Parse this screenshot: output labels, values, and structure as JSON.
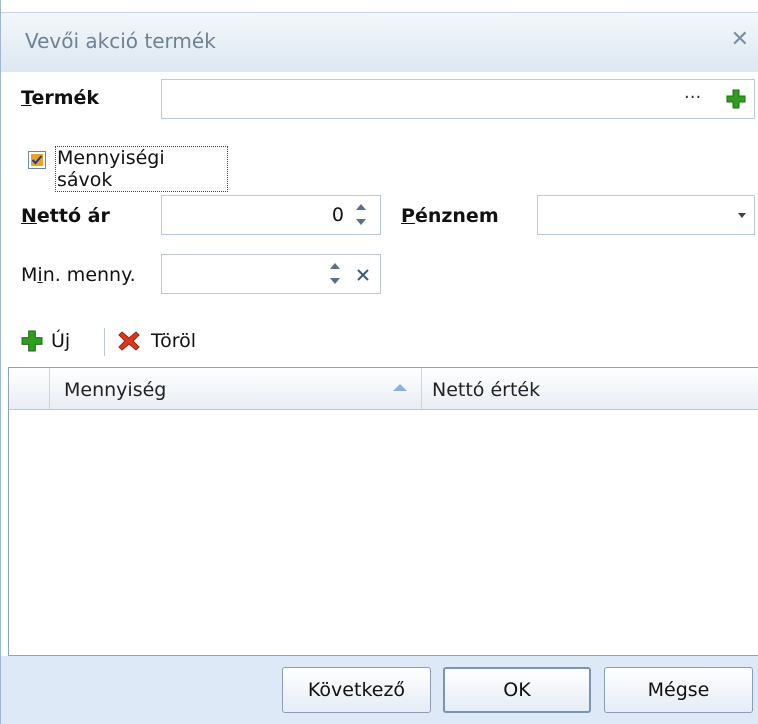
{
  "window": {
    "title": "Vevői akció termék",
    "close_glyph": "✕"
  },
  "form": {
    "product_label": "Termék",
    "product_value": "",
    "product_dots": "···",
    "checkbox_label": "Mennyiségi sávok",
    "checkbox_checked": true,
    "net_price_label": "Nettó ár",
    "net_price_value": "0",
    "currency_label": "Pénznem",
    "currency_value": "",
    "min_qty_label": "Min. menny.",
    "min_qty_value": ""
  },
  "toolbar": {
    "new_label": "Új",
    "delete_label": "Töröl"
  },
  "grid": {
    "columns": [
      "Mennyiség",
      "Nettó érték"
    ],
    "rows": []
  },
  "buttons": {
    "next": "Következő",
    "ok": "OK",
    "cancel": "Mégse"
  },
  "colors": {
    "plus_green": "#2e9e1f",
    "delete_red": "#d9381e",
    "checkbox_orange": "#f0a020"
  }
}
